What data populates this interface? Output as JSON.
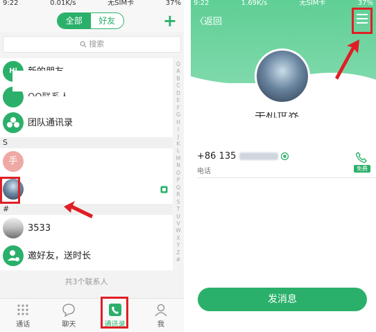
{
  "left_panel": {
    "status": {
      "time": "9:22",
      "network": "0.01K/s",
      "carrier": "无SIM卡",
      "battery": "37%"
    },
    "segment": {
      "all": "全部",
      "friends": "好友"
    },
    "plus_icon": "plus-icon",
    "search": {
      "placeholder": "搜索"
    },
    "contacts_top": [
      {
        "label": "新的朋友",
        "avatar_text": "Hi"
      },
      {
        "label": "QQ联系人"
      },
      {
        "label": "团队通讯录"
      }
    ],
    "section_s": "S",
    "contact_hand": {
      "avatar_text": "手"
    },
    "section_hash": "#",
    "contact_3533": {
      "label": "3533"
    },
    "invite": {
      "label": "邀好友，送时长"
    },
    "count_text": "共3个联系人",
    "index_letters": [
      "Q",
      "A",
      "B",
      "C",
      "D",
      "E",
      "F",
      "G",
      "H",
      "I",
      "J",
      "K",
      "L",
      "M",
      "N",
      "O",
      "P",
      "Q",
      "R",
      "S",
      "T",
      "U",
      "V",
      "W",
      "X",
      "Y",
      "Z",
      "#"
    ],
    "tabs": [
      {
        "label": "通话",
        "icon": "dialpad-icon"
      },
      {
        "label": "聊天",
        "icon": "chat-icon"
      },
      {
        "label": "通讯录",
        "icon": "contacts-icon"
      },
      {
        "label": "我",
        "icon": "person-icon"
      }
    ]
  },
  "right_panel": {
    "status": {
      "time": "9:22",
      "network": "1.69K/s",
      "carrier": "无SIM卡",
      "battery": "37%"
    },
    "back_label": "〈返回",
    "name_partial": "手机世界",
    "phone_prefix": "+86 135",
    "phone_type": "电话",
    "free_badge": "免费",
    "send_button": "发消息"
  },
  "colors": {
    "accent": "#2ab06a",
    "annotation": "#e01e25"
  }
}
